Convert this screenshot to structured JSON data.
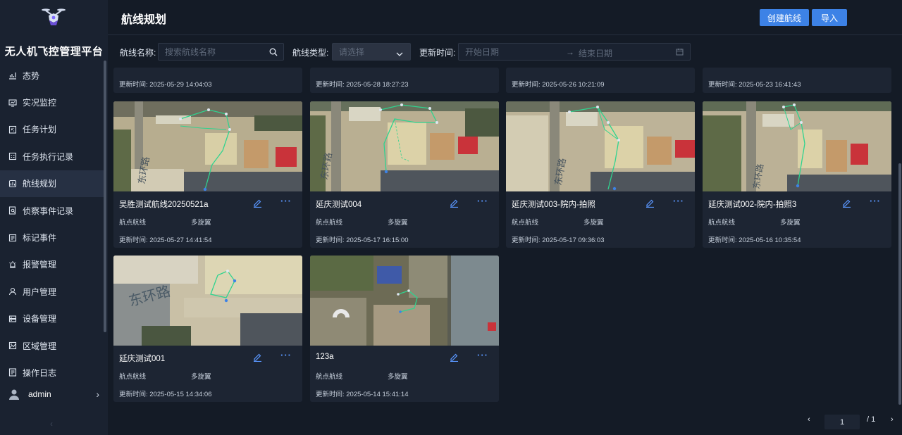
{
  "app": {
    "title": "无人机飞控管理平台"
  },
  "sidebar": {
    "items": [
      {
        "label": "态势",
        "icon": "chart-icon"
      },
      {
        "label": "实况监控",
        "icon": "monitor-icon"
      },
      {
        "label": "任务计划",
        "icon": "plan-icon"
      },
      {
        "label": "任务执行记录",
        "icon": "record-icon"
      },
      {
        "label": "航线规划",
        "icon": "route-icon",
        "active": true
      },
      {
        "label": "侦察事件记录",
        "icon": "search-doc-icon"
      },
      {
        "label": "标记事件",
        "icon": "mark-icon"
      },
      {
        "label": "报警管理",
        "icon": "alarm-icon"
      },
      {
        "label": "用户管理",
        "icon": "user-icon"
      },
      {
        "label": "设备管理",
        "icon": "device-icon"
      },
      {
        "label": "区域管理",
        "icon": "area-icon"
      },
      {
        "label": "操作日志",
        "icon": "log-icon"
      }
    ],
    "user": {
      "name": "admin"
    }
  },
  "header": {
    "title": "航线规划",
    "create_label": "创建航线",
    "import_label": "导入"
  },
  "filters": {
    "name_label": "航线名称:",
    "name_placeholder": "搜索航线名称",
    "type_label": "航线类型:",
    "type_placeholder": "请选择",
    "time_label": "更新时间:",
    "start_placeholder": "开始日期",
    "end_placeholder": "结束日期",
    "arrow": "→"
  },
  "top_strips": [
    {
      "time": "更新时间: 2025-05-29 14:04:03"
    },
    {
      "time": "更新时间: 2025-05-28 18:27:23"
    },
    {
      "time": "更新时间: 2025-05-26 10:21:09"
    },
    {
      "time": "更新时间: 2025-05-23 16:41:43"
    }
  ],
  "cards": [
    {
      "name": "吴胜测试航线20250521a",
      "type": "航点航线",
      "drone": "多旋翼",
      "time": "更新时间: 2025-05-27 14:41:54",
      "more": "···"
    },
    {
      "name": "延庆测试004",
      "type": "航点航线",
      "drone": "多旋翼",
      "time": "更新时间: 2025-05-17 16:15:00",
      "more": "···"
    },
    {
      "name": "延庆测试003-院内-拍照",
      "type": "航点航线",
      "drone": "多旋翼",
      "time": "更新时间: 2025-05-17 09:36:03",
      "more": "···"
    },
    {
      "name": "延庆测试002-院内-拍照3",
      "type": "航点航线",
      "drone": "多旋翼",
      "time": "更新时间: 2025-05-16 10:35:54",
      "more": "···"
    },
    {
      "name": "延庆测试001",
      "type": "航点航线",
      "drone": "多旋翼",
      "time": "更新时间: 2025-05-15 14:34:06",
      "more": "···"
    },
    {
      "name": "123a",
      "type": "航点航线",
      "drone": "多旋翼",
      "time": "更新时间: 2025-05-14 15:41:14",
      "more": "···"
    }
  ],
  "map_labels": {
    "road": "东环路"
  },
  "pagination": {
    "prev": "‹",
    "current": "1",
    "total": "/ 1",
    "next": "›"
  },
  "colors": {
    "accent": "#3d82e6",
    "route": "#2fd38f",
    "background": "#141b26",
    "card": "#1d2533"
  }
}
